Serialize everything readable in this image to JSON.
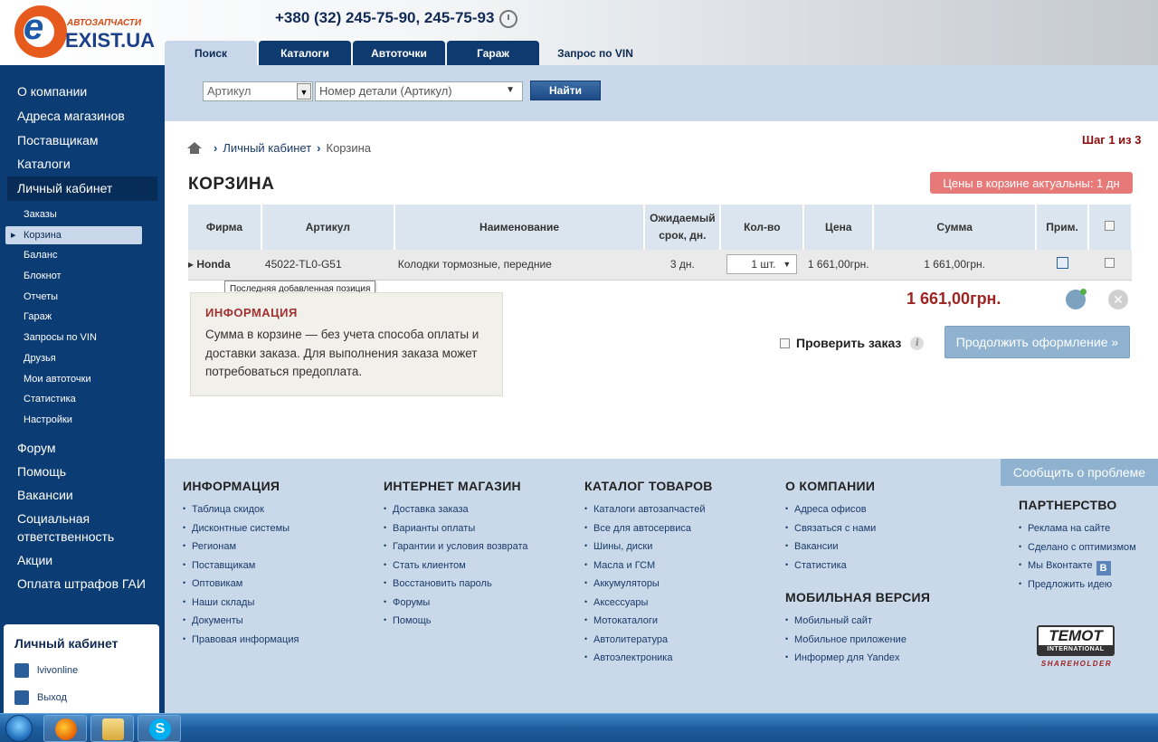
{
  "header": {
    "logo_sub": "АВТОЗАПЧАСТИ",
    "logo_brand": "EXIST.UA",
    "phone": "+380 (32) 245-75-90, 245-75-93",
    "tabs": [
      {
        "label": "Поиск",
        "style": "active"
      },
      {
        "label": "Каталоги",
        "style": "dark"
      },
      {
        "label": "Автоточки",
        "style": "dark"
      },
      {
        "label": "Гараж",
        "style": "dark"
      },
      {
        "label": "Запрос по VIN",
        "style": "plain"
      }
    ]
  },
  "search": {
    "type_value": "Артикул",
    "part_placeholder": "Номер детали (Артикул)",
    "button": "Найти"
  },
  "sidebar": {
    "items_top": [
      "О компании",
      "Адреса магазинов",
      "Поставщикам",
      "Каталоги",
      "Личный кабинет"
    ],
    "selected_index": 4,
    "subitems": [
      "Заказы",
      "Корзина",
      "Баланс",
      "Блокнот",
      "Отчеты",
      "Гараж",
      "Запросы по VIN",
      "Друзья",
      "Мои автоточки",
      "Статистика",
      "Настройки"
    ],
    "active_sub_index": 1,
    "items_bottom": [
      "Форум",
      "Помощь",
      "Вакансии",
      "Социальная ответственность",
      "Акции",
      "Оплата штрафов ГАИ"
    ],
    "account_box": {
      "title": "Личный кабинет",
      "user": "lvivonline",
      "logout": "Выход"
    }
  },
  "main": {
    "breadcrumb": [
      "Личный кабинет",
      "Корзина"
    ],
    "step": "Шаг 1 из 3",
    "title": "КОРЗИНА",
    "price_badge": "Цены в корзине актуальны: 1 дн",
    "table": {
      "headers": [
        "Фирма",
        "Артикул",
        "Наименование",
        "Ожидаемый срок, дн.",
        "Кол-во",
        "Цена",
        "Сумма",
        "Прим."
      ],
      "rows": [
        {
          "brand": "Honda",
          "article": "45022-TL0-G51",
          "name": "Колодки тормозные, передние",
          "term": "3 дн.",
          "qty": "1 шт.",
          "price": "1 661,00грн.",
          "sum": "1 661,00грн."
        }
      ]
    },
    "tooltip": "Последняя добавленная позиция",
    "info": {
      "title": "ИНФОРМАЦИЯ",
      "text": "Сумма в корзине — без учета способа оплаты и доставки заказа. Для выполнения заказа может потребоваться предоплата."
    },
    "total": "1 661,00грн.",
    "check_order": "Проверить заказ",
    "continue_button": "Продолжить оформление »"
  },
  "footer": {
    "report_button": "Сообщить о проблеме",
    "columns": [
      {
        "title": "ИНФОРМАЦИЯ",
        "links": [
          "Таблица скидок",
          "Дисконтные системы",
          "Регионам",
          "Поставщикам",
          "Оптовикам",
          "Наши склады",
          "Документы",
          "Правовая информация"
        ]
      },
      {
        "title": "ИНТЕРНЕТ МАГАЗИН",
        "links": [
          "Доставка заказа",
          "Варианты оплаты",
          "Гарантии и условия возврата",
          "Стать клиентом",
          "Восстановить пароль",
          "Форумы",
          "Помощь"
        ]
      },
      {
        "title": "КАТАЛОГ ТОВАРОВ",
        "links": [
          "Каталоги автозапчастей",
          "Все для автосервиса",
          "Шины, диски",
          "Масла и ГСМ",
          "Аккумуляторы",
          "Аксессуары",
          "Мотокаталоги",
          "Автолитература",
          "Автоэлектроника"
        ]
      },
      {
        "title": "О КОМПАНИИ",
        "links": [
          "Адреса офисов",
          "Связаться с нами",
          "Вакансии",
          "Статистика"
        ]
      },
      {
        "title": "МОБИЛЬНАЯ ВЕРСИЯ",
        "links": [
          "Мобильный сайт",
          "Мобильное приложение",
          "Информер для Yandex"
        ]
      },
      {
        "title": "ПАРТНЕРСТВО",
        "links": [
          "Реклама на сайте",
          "Сделано с оптимизмом",
          "Мы Вконтакте",
          "Предложить идею"
        ]
      }
    ],
    "vk_badge": "B",
    "partner_logo": {
      "name": "TEMOT",
      "sub": "INTERNATIONAL",
      "tag": "SHAREHOLDER"
    }
  },
  "taskbar": {
    "apps": [
      "firefox-icon",
      "explorer-icon",
      "skype-icon"
    ]
  }
}
